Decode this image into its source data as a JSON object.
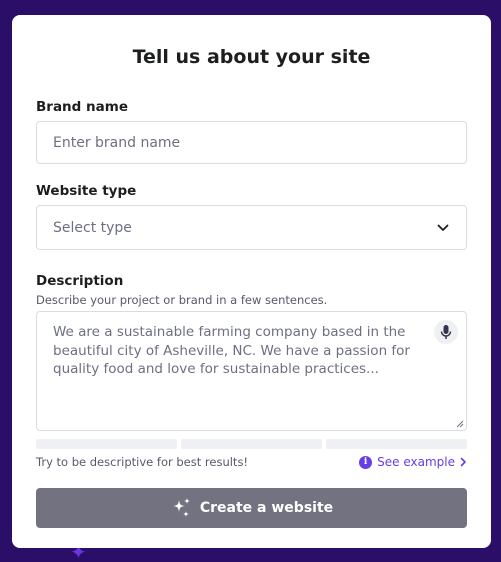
{
  "form": {
    "title": "Tell us about your site",
    "brand": {
      "label": "Brand name",
      "placeholder": "Enter brand name",
      "value": ""
    },
    "website_type": {
      "label": "Website type",
      "selected": "Select type"
    },
    "description": {
      "label": "Description",
      "hint": "Describe your project or brand in a few sentences.",
      "placeholder": "We are a sustainable farming company based in the beautiful city of Asheville, NC. We have a passion for quality food and love for sustainable practices...",
      "footer_hint": "Try to be descriptive for best results!",
      "see_example": "See example"
    },
    "submit_label": "Create a website"
  },
  "colors": {
    "background": "#2a0e68",
    "accent": "#673de6",
    "button_disabled": "#737281"
  },
  "icons": {
    "select": "chevron-down-icon",
    "mic": "microphone-icon",
    "info": "info-icon",
    "example_arrow": "chevron-right-icon",
    "cta": "sparkles-icon"
  }
}
